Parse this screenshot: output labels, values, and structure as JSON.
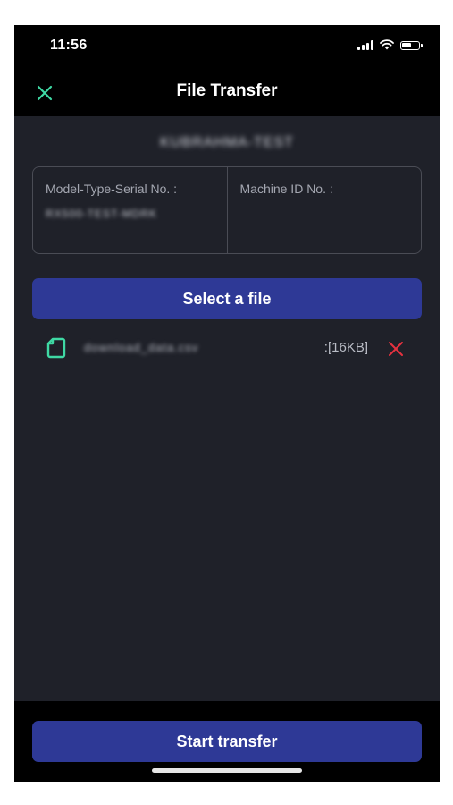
{
  "status_bar": {
    "time": "11:56",
    "battery_level": 0.6
  },
  "header": {
    "title": "File Transfer",
    "close_icon": "close-icon"
  },
  "machine": {
    "name": "KUBRAHMA-TEST"
  },
  "info_card": {
    "model_type_serial_label": "Model-Type-Serial No. :",
    "model_type_serial_value": "RX500-TEST-MDRK",
    "machine_id_label": "Machine ID No. :",
    "machine_id_value": ""
  },
  "actions": {
    "select_file_label": "Select a file",
    "start_transfer_label": "Start transfer"
  },
  "files": [
    {
      "name": "download_data.csv",
      "size": ":[16KB]",
      "icon": "file-icon",
      "remove_icon": "remove-icon"
    }
  ],
  "colors": {
    "accent_button": "#2e3996",
    "close_icon": "#3fd9a4",
    "file_icon": "#3fd9a4",
    "remove_icon": "#e5323f",
    "background": "#1f2129",
    "header_background": "#000000"
  }
}
